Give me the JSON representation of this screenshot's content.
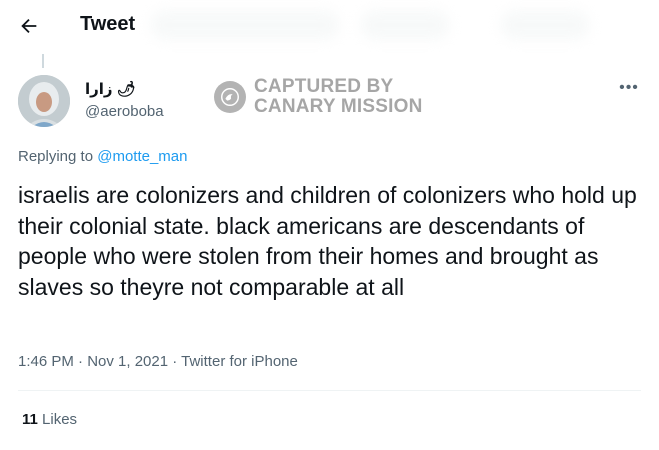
{
  "header": {
    "back_icon": "arrow-left-icon",
    "title": "Tweet"
  },
  "author": {
    "display_name": "زارا 🌶",
    "handle": "@aeroboba",
    "avatar_icon": "user-avatar"
  },
  "watermark": {
    "line1": "CAPTURED BY",
    "line2": "CANARY MISSION",
    "logo_icon": "canary-bird-icon",
    "color": "#a6a6a6"
  },
  "more_icon": "more-horizontal-icon",
  "reply": {
    "prefix": "Replying to ",
    "to": "@motte_man"
  },
  "tweet": {
    "text": "israelis are colonizers and children of colonizers who hold up their colonial state. black americans are descendants of people who were stolen from their homes and brought as slaves so theyre not comparable at all"
  },
  "meta": {
    "line": "1:46 PM · Nov 1, 2021 · Twitter for iPhone"
  },
  "stats": {
    "likes_count": "11",
    "likes_label": " Likes"
  },
  "colors": {
    "link": "#1d9bf0",
    "text": "#0f1419",
    "secondary": "#536471"
  }
}
